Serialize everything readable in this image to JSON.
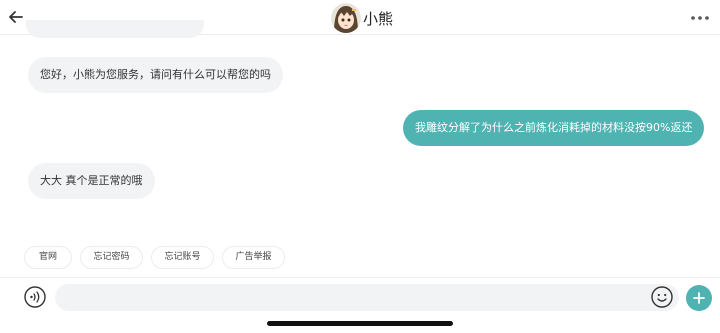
{
  "header": {
    "agent_name": "小熊",
    "avatar_icon": "cartoon-girl-avatar",
    "back_icon": "arrow-left-icon",
    "more_icon": "more-horizontal-icon"
  },
  "messages": [
    {
      "from": "agent",
      "text": "您好，小熊为您服务，请问有什么可以帮您的吗"
    },
    {
      "from": "user",
      "text": "我雕纹分解了为什么之前炼化消耗掉的材料没按90%返还"
    },
    {
      "from": "agent",
      "text": "大大 真个是正常的哦"
    }
  ],
  "quick_replies": [
    "官网",
    "忘记密码",
    "忘记账号",
    "广告举报"
  ],
  "input": {
    "value": "",
    "placeholder": ""
  },
  "icons": {
    "voice": "voice-input-icon",
    "emoji": "emoji-icon",
    "plus": "plus-icon"
  },
  "colors": {
    "accent": "#4fb3b2",
    "bubble_agent": "#f2f3f5",
    "bubble_user": "#4fb3b2"
  }
}
